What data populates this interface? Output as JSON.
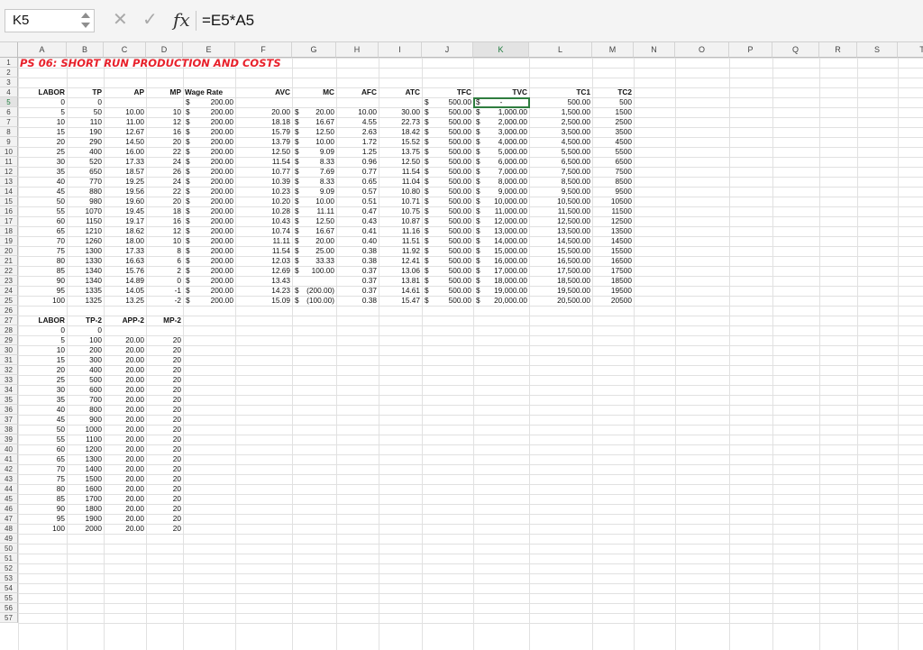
{
  "formula_bar": {
    "name_box": "K5",
    "cancel_glyph": "✕",
    "enter_glyph": "✓",
    "fx_label": "fx",
    "formula": "=E5*A5"
  },
  "columns": [
    "A",
    "B",
    "C",
    "D",
    "E",
    "F",
    "G",
    "H",
    "I",
    "J",
    "K",
    "L",
    "M",
    "N",
    "O",
    "P",
    "Q",
    "R",
    "S",
    "T"
  ],
  "rows_visible": 57,
  "selected": {
    "col": "K",
    "row": 5
  },
  "title": {
    "text": "PS 06: SHORT RUN PRODUCTION AND COSTS",
    "color": "#e8212b"
  },
  "colors": {
    "accent": "#2f7d3f",
    "title": "#e8212b",
    "grid": "#e1e1e1"
  },
  "table1": {
    "header_row": 4,
    "headers": {
      "A": "LABOR",
      "B": "TP",
      "C": "AP",
      "D": "MP",
      "E": "Wage Rate",
      "F": "AVC",
      "G": "MC",
      "H": "AFC",
      "I": "ATC",
      "J": "TFC",
      "K": "TVC",
      "L": "TC1",
      "M": "TC2"
    },
    "rows": [
      {
        "A": "0",
        "B": "0",
        "C": "",
        "D": "",
        "E": "200.00",
        "F": "",
        "G": "",
        "H": "",
        "I": "",
        "J": "500.00",
        "K": "-",
        "L": "500.00",
        "M": "500"
      },
      {
        "A": "5",
        "B": "50",
        "C": "10.00",
        "D": "10",
        "E": "200.00",
        "F": "20.00",
        "G": "20.00",
        "H": "10.00",
        "I": "30.00",
        "J": "500.00",
        "K": "1,000.00",
        "L": "1,500.00",
        "M": "1500"
      },
      {
        "A": "10",
        "B": "110",
        "C": "11.00",
        "D": "12",
        "E": "200.00",
        "F": "18.18",
        "G": "16.67",
        "H": "4.55",
        "I": "22.73",
        "J": "500.00",
        "K": "2,000.00",
        "L": "2,500.00",
        "M": "2500"
      },
      {
        "A": "15",
        "B": "190",
        "C": "12.67",
        "D": "16",
        "E": "200.00",
        "F": "15.79",
        "G": "12.50",
        "H": "2.63",
        "I": "18.42",
        "J": "500.00",
        "K": "3,000.00",
        "L": "3,500.00",
        "M": "3500"
      },
      {
        "A": "20",
        "B": "290",
        "C": "14.50",
        "D": "20",
        "E": "200.00",
        "F": "13.79",
        "G": "10.00",
        "H": "1.72",
        "I": "15.52",
        "J": "500.00",
        "K": "4,000.00",
        "L": "4,500.00",
        "M": "4500"
      },
      {
        "A": "25",
        "B": "400",
        "C": "16.00",
        "D": "22",
        "E": "200.00",
        "F": "12.50",
        "G": "9.09",
        "H": "1.25",
        "I": "13.75",
        "J": "500.00",
        "K": "5,000.00",
        "L": "5,500.00",
        "M": "5500"
      },
      {
        "A": "30",
        "B": "520",
        "C": "17.33",
        "D": "24",
        "E": "200.00",
        "F": "11.54",
        "G": "8.33",
        "H": "0.96",
        "I": "12.50",
        "J": "500.00",
        "K": "6,000.00",
        "L": "6,500.00",
        "M": "6500"
      },
      {
        "A": "35",
        "B": "650",
        "C": "18.57",
        "D": "26",
        "E": "200.00",
        "F": "10.77",
        "G": "7.69",
        "H": "0.77",
        "I": "11.54",
        "J": "500.00",
        "K": "7,000.00",
        "L": "7,500.00",
        "M": "7500"
      },
      {
        "A": "40",
        "B": "770",
        "C": "19.25",
        "D": "24",
        "E": "200.00",
        "F": "10.39",
        "G": "8.33",
        "H": "0.65",
        "I": "11.04",
        "J": "500.00",
        "K": "8,000.00",
        "L": "8,500.00",
        "M": "8500"
      },
      {
        "A": "45",
        "B": "880",
        "C": "19.56",
        "D": "22",
        "E": "200.00",
        "F": "10.23",
        "G": "9.09",
        "H": "0.57",
        "I": "10.80",
        "J": "500.00",
        "K": "9,000.00",
        "L": "9,500.00",
        "M": "9500"
      },
      {
        "A": "50",
        "B": "980",
        "C": "19.60",
        "D": "20",
        "E": "200.00",
        "F": "10.20",
        "G": "10.00",
        "H": "0.51",
        "I": "10.71",
        "J": "500.00",
        "K": "10,000.00",
        "L": "10,500.00",
        "M": "10500"
      },
      {
        "A": "55",
        "B": "1070",
        "C": "19.45",
        "D": "18",
        "E": "200.00",
        "F": "10.28",
        "G": "11.11",
        "H": "0.47",
        "I": "10.75",
        "J": "500.00",
        "K": "11,000.00",
        "L": "11,500.00",
        "M": "11500"
      },
      {
        "A": "60",
        "B": "1150",
        "C": "19.17",
        "D": "16",
        "E": "200.00",
        "F": "10.43",
        "G": "12.50",
        "H": "0.43",
        "I": "10.87",
        "J": "500.00",
        "K": "12,000.00",
        "L": "12,500.00",
        "M": "12500"
      },
      {
        "A": "65",
        "B": "1210",
        "C": "18.62",
        "D": "12",
        "E": "200.00",
        "F": "10.74",
        "G": "16.67",
        "H": "0.41",
        "I": "11.16",
        "J": "500.00",
        "K": "13,000.00",
        "L": "13,500.00",
        "M": "13500"
      },
      {
        "A": "70",
        "B": "1260",
        "C": "18.00",
        "D": "10",
        "E": "200.00",
        "F": "11.11",
        "G": "20.00",
        "H": "0.40",
        "I": "11.51",
        "J": "500.00",
        "K": "14,000.00",
        "L": "14,500.00",
        "M": "14500"
      },
      {
        "A": "75",
        "B": "1300",
        "C": "17.33",
        "D": "8",
        "E": "200.00",
        "F": "11.54",
        "G": "25.00",
        "H": "0.38",
        "I": "11.92",
        "J": "500.00",
        "K": "15,000.00",
        "L": "15,500.00",
        "M": "15500"
      },
      {
        "A": "80",
        "B": "1330",
        "C": "16.63",
        "D": "6",
        "E": "200.00",
        "F": "12.03",
        "G": "33.33",
        "H": "0.38",
        "I": "12.41",
        "J": "500.00",
        "K": "16,000.00",
        "L": "16,500.00",
        "M": "16500"
      },
      {
        "A": "85",
        "B": "1340",
        "C": "15.76",
        "D": "2",
        "E": "200.00",
        "F": "12.69",
        "G": "100.00",
        "H": "0.37",
        "I": "13.06",
        "J": "500.00",
        "K": "17,000.00",
        "L": "17,500.00",
        "M": "17500"
      },
      {
        "A": "90",
        "B": "1340",
        "C": "14.89",
        "D": "0",
        "E": "200.00",
        "F": "13.43",
        "G": "",
        "H": "0.37",
        "I": "13.81",
        "J": "500.00",
        "K": "18,000.00",
        "L": "18,500.00",
        "M": "18500"
      },
      {
        "A": "95",
        "B": "1335",
        "C": "14.05",
        "D": "-1",
        "E": "200.00",
        "F": "14.23",
        "G": "(200.00)",
        "H": "0.37",
        "I": "14.61",
        "J": "500.00",
        "K": "19,000.00",
        "L": "19,500.00",
        "M": "19500"
      },
      {
        "A": "100",
        "B": "1325",
        "C": "13.25",
        "D": "-2",
        "E": "200.00",
        "F": "15.09",
        "G": "(100.00)",
        "H": "0.38",
        "I": "15.47",
        "J": "500.00",
        "K": "20,000.00",
        "L": "20,500.00",
        "M": "20500"
      }
    ]
  },
  "table2": {
    "header_row": 27,
    "headers": {
      "A": "LABOR",
      "B": "TP-2",
      "C": "APP-2",
      "D": "MP-2"
    },
    "rows": [
      {
        "A": "0",
        "B": "0",
        "C": "",
        "D": ""
      },
      {
        "A": "5",
        "B": "100",
        "C": "20.00",
        "D": "20"
      },
      {
        "A": "10",
        "B": "200",
        "C": "20.00",
        "D": "20"
      },
      {
        "A": "15",
        "B": "300",
        "C": "20.00",
        "D": "20"
      },
      {
        "A": "20",
        "B": "400",
        "C": "20.00",
        "D": "20"
      },
      {
        "A": "25",
        "B": "500",
        "C": "20.00",
        "D": "20"
      },
      {
        "A": "30",
        "B": "600",
        "C": "20.00",
        "D": "20"
      },
      {
        "A": "35",
        "B": "700",
        "C": "20.00",
        "D": "20"
      },
      {
        "A": "40",
        "B": "800",
        "C": "20.00",
        "D": "20"
      },
      {
        "A": "45",
        "B": "900",
        "C": "20.00",
        "D": "20"
      },
      {
        "A": "50",
        "B": "1000",
        "C": "20.00",
        "D": "20"
      },
      {
        "A": "55",
        "B": "1100",
        "C": "20.00",
        "D": "20"
      },
      {
        "A": "60",
        "B": "1200",
        "C": "20.00",
        "D": "20"
      },
      {
        "A": "65",
        "B": "1300",
        "C": "20.00",
        "D": "20"
      },
      {
        "A": "70",
        "B": "1400",
        "C": "20.00",
        "D": "20"
      },
      {
        "A": "75",
        "B": "1500",
        "C": "20.00",
        "D": "20"
      },
      {
        "A": "80",
        "B": "1600",
        "C": "20.00",
        "D": "20"
      },
      {
        "A": "85",
        "B": "1700",
        "C": "20.00",
        "D": "20"
      },
      {
        "A": "90",
        "B": "1800",
        "C": "20.00",
        "D": "20"
      },
      {
        "A": "95",
        "B": "1900",
        "C": "20.00",
        "D": "20"
      },
      {
        "A": "100",
        "B": "2000",
        "C": "20.00",
        "D": "20"
      }
    ]
  }
}
